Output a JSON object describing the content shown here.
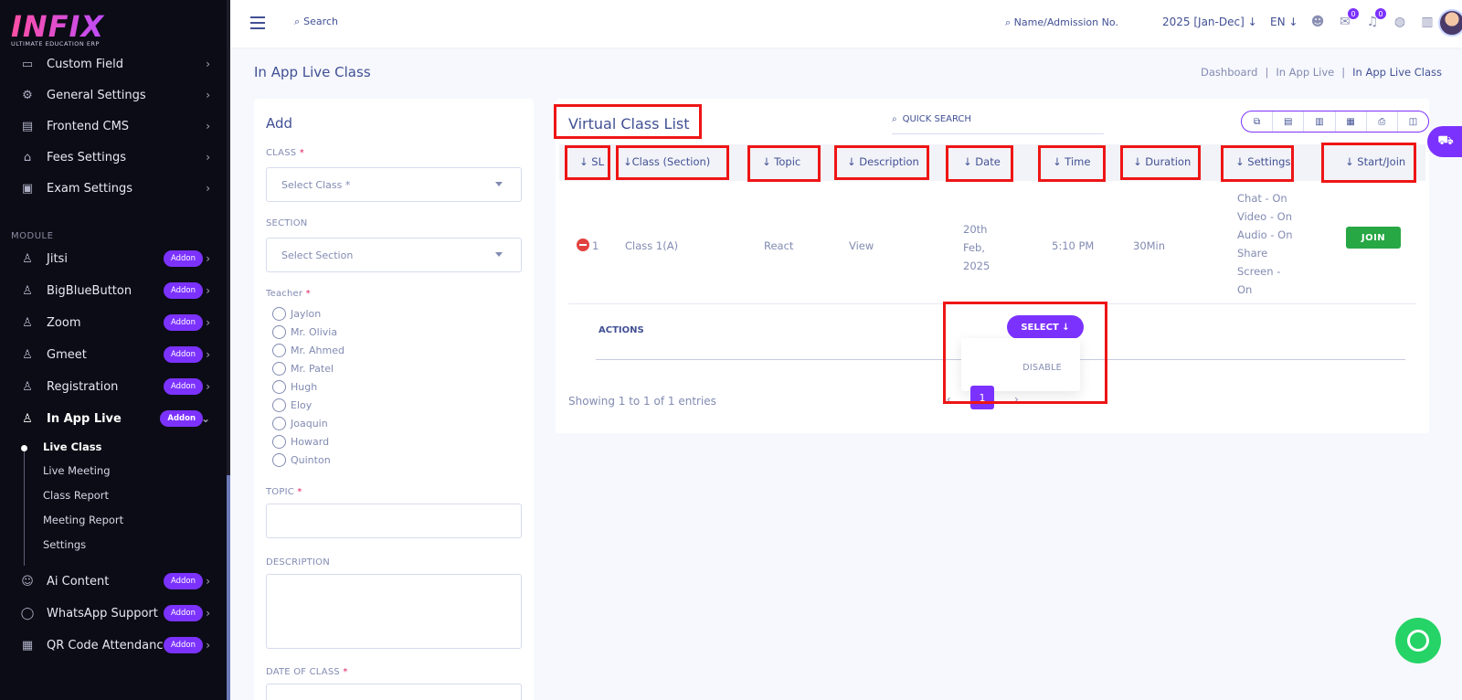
{
  "brand": {
    "name": "INFIX",
    "tagline": "ULTIMATE EDUCATION ERP"
  },
  "sidebar": {
    "items_top": [
      {
        "label": "Custom Field",
        "icon": "form-icon"
      },
      {
        "label": "General Settings",
        "icon": "gears-icon"
      },
      {
        "label": "Frontend CMS",
        "icon": "cms-icon"
      },
      {
        "label": "Fees Settings",
        "icon": "bank-icon"
      },
      {
        "label": "Exam Settings",
        "icon": "exam-icon"
      }
    ],
    "module_label": "MODULE",
    "modules": [
      {
        "label": "Jitsi",
        "badge": "Addon"
      },
      {
        "label": "BigBlueButton",
        "badge": "Addon"
      },
      {
        "label": "Zoom",
        "badge": "Addon"
      },
      {
        "label": "Gmeet",
        "badge": "Addon"
      },
      {
        "label": "Registration",
        "badge": "Addon"
      },
      {
        "label": "In App Live",
        "badge": "Addon"
      }
    ],
    "submenu": [
      "Live Class",
      "Live Meeting",
      "Class Report",
      "Meeting Report",
      "Settings"
    ],
    "modules_bottom": [
      {
        "label": "Ai Content",
        "badge": "Addon"
      },
      {
        "label": "WhatsApp Support",
        "badge": "Addon"
      },
      {
        "label": "QR Code Attendance",
        "badge": "Addon"
      }
    ]
  },
  "topbar": {
    "search_label": "Search",
    "name_search": "Name/Admission No.",
    "year": "2025 [Jan-Dec]",
    "lang": "EN",
    "chat_badge": "0",
    "notif_badge": "0"
  },
  "page": {
    "title": "In App Live Class",
    "breadcrumb": [
      "Dashboard",
      "In App Live",
      "In App Live Class"
    ]
  },
  "add_form": {
    "title": "Add",
    "class_label": "CLASS",
    "class_placeholder": "Select Class *",
    "section_label": "SECTION",
    "section_placeholder": "Select Section",
    "teacher_label": "Teacher",
    "teachers": [
      "Jaylon",
      "Mr. Olivia",
      "Mr. Ahmed",
      "Mr. Patel",
      "Hugh",
      "Eloy",
      "Joaquin",
      "Howard",
      "Quinton"
    ],
    "topic_label": "TOPIC",
    "description_label": "DESCRIPTION",
    "date_label": "DATE OF CLASS",
    "required_mark": "*"
  },
  "list": {
    "title": "Virtual Class List",
    "quick_search": "QUICK SEARCH",
    "columns": [
      "SL",
      "Class (Section)",
      "Topic",
      "Description",
      "Date",
      "Time",
      "Duration",
      "Settings",
      "Start/Join"
    ],
    "sort_arrow": "↓",
    "row": {
      "sl": "1",
      "class_section": "Class 1(A)",
      "topic": "React",
      "description": "View",
      "date_lines": [
        "20th",
        "Feb,",
        "2025"
      ],
      "time": "5:10 PM",
      "duration": "30Min",
      "settings_lines": [
        "Chat - On",
        "Video - On",
        "Audio - On",
        "Share",
        "Screen -",
        "On"
      ],
      "join_label": "JOIN"
    },
    "actions_label": "ACTIONS",
    "select_label": "SELECT ↓",
    "dropdown_option": "DISABLE",
    "showing": "Showing 1 to 1 of 1 entries",
    "page": "1"
  },
  "colors": {
    "accent": "#7c32ff",
    "highlight": "#ee1515",
    "join": "#28a745",
    "text": "#415094"
  }
}
